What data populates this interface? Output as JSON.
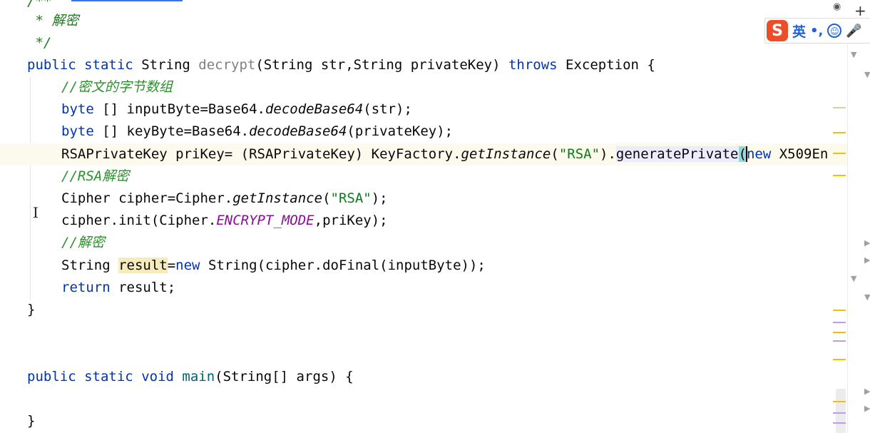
{
  "editor": {
    "doc_open": "/**",
    "doc_line": " * 解密",
    "doc_close": " */",
    "decrypt": {
      "kw1": "public",
      "kw2": "static",
      "type": "String",
      "name": "decrypt",
      "params": "(String str,String privateKey) ",
      "throws": "throws",
      "rest": " Exception {"
    },
    "comment_bytes": "//密文的字节数组",
    "line_input": {
      "kw": "byte",
      "a": " [] inputByte=Base64.",
      "call": "decodeBase64",
      "b": "(str);"
    },
    "line_key": {
      "kw": "byte",
      "a": " [] keyByte=Base64.",
      "call": "decodeBase64",
      "b": "(privateKey);"
    },
    "line_prikey": {
      "a": "RSAPrivateKey priKey= (RSAPrivateKey) KeyFactory.",
      "call": "getInstance",
      "b": "(",
      "str": "\"RSA\"",
      "c": ").",
      "method": "generatePrivate",
      "paren": "(",
      "kw": "new",
      "d": " X509En"
    },
    "comment_rsa": "//RSA解密",
    "line_cipher": {
      "a": "Cipher cipher=Cipher.",
      "call": "getInstance",
      "b": "(",
      "str": "\"RSA\"",
      "c": ");"
    },
    "line_init": {
      "a": "cipher.init(Cipher.",
      "const": "ENCRYPT_MODE",
      "b": ",priKey);"
    },
    "comment_decrypt": "//解密",
    "line_result": {
      "a": "String ",
      "var": "result",
      "b": "=",
      "kw": "new",
      "c": " String(cipher.doFinal(inputByte));"
    },
    "line_return": {
      "kw": "return",
      "a": " result;"
    },
    "close_brace": "}",
    "main": {
      "kw1": "public",
      "kw2": "static",
      "kw3": "void",
      "name": "main",
      "rest": "(String[] args) {"
    },
    "close_brace_2": "}"
  },
  "ime": {
    "logo": "S",
    "lang": "英",
    "punct": "•,",
    "smile": "☺",
    "mic": "🎤"
  },
  "toolbar": {
    "plus": "+",
    "eye": "◉"
  },
  "colors": {
    "keyword": "#0033b3",
    "string": "#067d17",
    "comment": "#8c8c8c",
    "static_field": "#871094",
    "ime_brand": "#ea4f2a"
  }
}
